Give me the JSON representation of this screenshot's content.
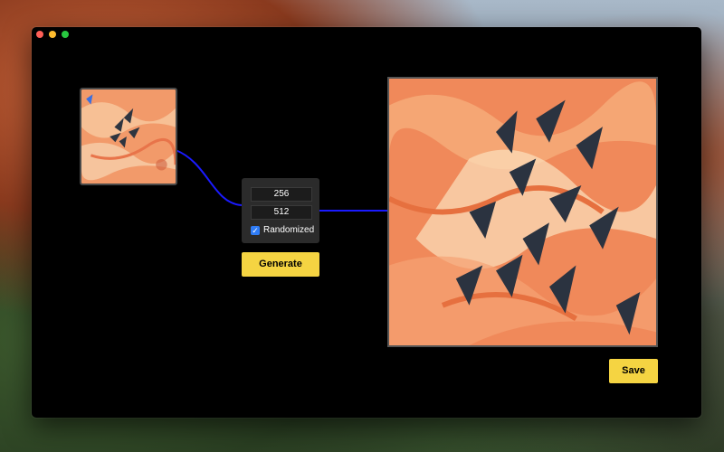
{
  "window": {
    "traffic_lights": [
      "close",
      "minimize",
      "zoom"
    ]
  },
  "thumbnail": {
    "icon": "source-artwork-image"
  },
  "preview": {
    "icon": "generated-artwork-image"
  },
  "params": {
    "size_small": "256",
    "size_large": "512",
    "randomized_label": "Randomized",
    "randomized_checked": true
  },
  "buttons": {
    "generate_label": "Generate",
    "save_label": "Save"
  },
  "colors": {
    "button_yellow": "#f5d442",
    "wire_blue": "#1a1aff",
    "checkbox_blue": "#2f7cf6",
    "art_orange": "#f08a5a"
  }
}
